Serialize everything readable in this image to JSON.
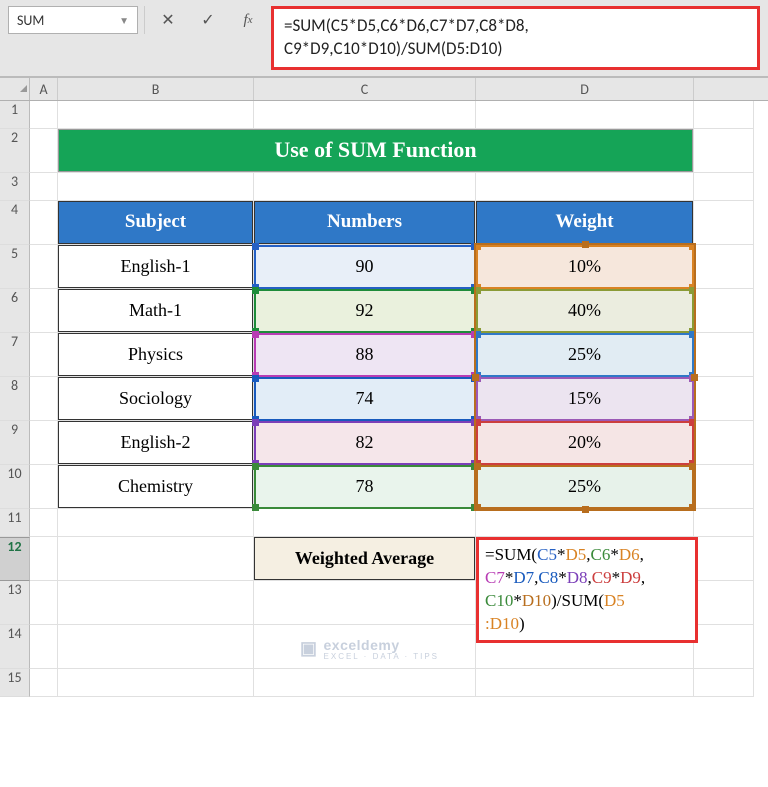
{
  "namebox": "SUM",
  "formula_bar": {
    "line1": "=SUM(C5*D5,C6*D6,C7*D7,C8*D8,",
    "line2": "C9*D9,C10*D10)/SUM(D5:D10)"
  },
  "columns": {
    "A": "A",
    "B": "B",
    "C": "C",
    "D": "D"
  },
  "row_labels": [
    "1",
    "2",
    "3",
    "4",
    "5",
    "6",
    "7",
    "8",
    "9",
    "10",
    "11",
    "12",
    "13",
    "14",
    "15"
  ],
  "title": "Use of SUM Function",
  "headers": {
    "subject": "Subject",
    "numbers": "Numbers",
    "weight": "Weight"
  },
  "table": [
    {
      "subject": "English-1",
      "numbers": "90",
      "weight": "10%"
    },
    {
      "subject": "Math-1",
      "numbers": "92",
      "weight": "40%"
    },
    {
      "subject": "Physics",
      "numbers": "88",
      "weight": "25%"
    },
    {
      "subject": "Sociology",
      "numbers": "74",
      "weight": "15%"
    },
    {
      "subject": "English-2",
      "numbers": "82",
      "weight": "20%"
    },
    {
      "subject": "Chemistry",
      "numbers": "78",
      "weight": "25%"
    }
  ],
  "weighted_label": "Weighted Average",
  "cell_formula": {
    "t1a": "=SUM(",
    "t1b": "C5",
    "t1c": "*",
    "t1d": "D5",
    "t1e": ",",
    "t1f": "C6",
    "t1g": "*",
    "t1h": "D6",
    "t1i": ",",
    "t2a": "C7",
    "t2b": "*",
    "t2c": "D7",
    "t2d": ",",
    "t2e": "C8",
    "t2f": "*",
    "t2g": "D8",
    "t2h": ",",
    "t2i": "C9",
    "t2j": "*",
    "t2k": "D9",
    "t2l": ",",
    "t3a": "C10",
    "t3b": "*",
    "t3c": "D10",
    "t3d": ")/SUM(",
    "t3e": "D5",
    "t4a": ":",
    "t4b": "D10",
    "t4c": ")"
  },
  "watermark": {
    "brand": "exceldemy",
    "tag": "EXCEL · DATA · TIPS"
  },
  "chart_data": {
    "type": "table",
    "title": "Use of SUM Function",
    "columns": [
      "Subject",
      "Numbers",
      "Weight"
    ],
    "rows": [
      [
        "English-1",
        90,
        "10%"
      ],
      [
        "Math-1",
        92,
        "40%"
      ],
      [
        "Physics",
        88,
        "25%"
      ],
      [
        "Sociology",
        74,
        "15%"
      ],
      [
        "English-2",
        82,
        "20%"
      ],
      [
        "Chemistry",
        78,
        "25%"
      ]
    ],
    "formula": "=SUM(C5*D5,C6*D6,C7*D7,C8*D8,C9*D9,C10*D10)/SUM(D5:D10)"
  }
}
